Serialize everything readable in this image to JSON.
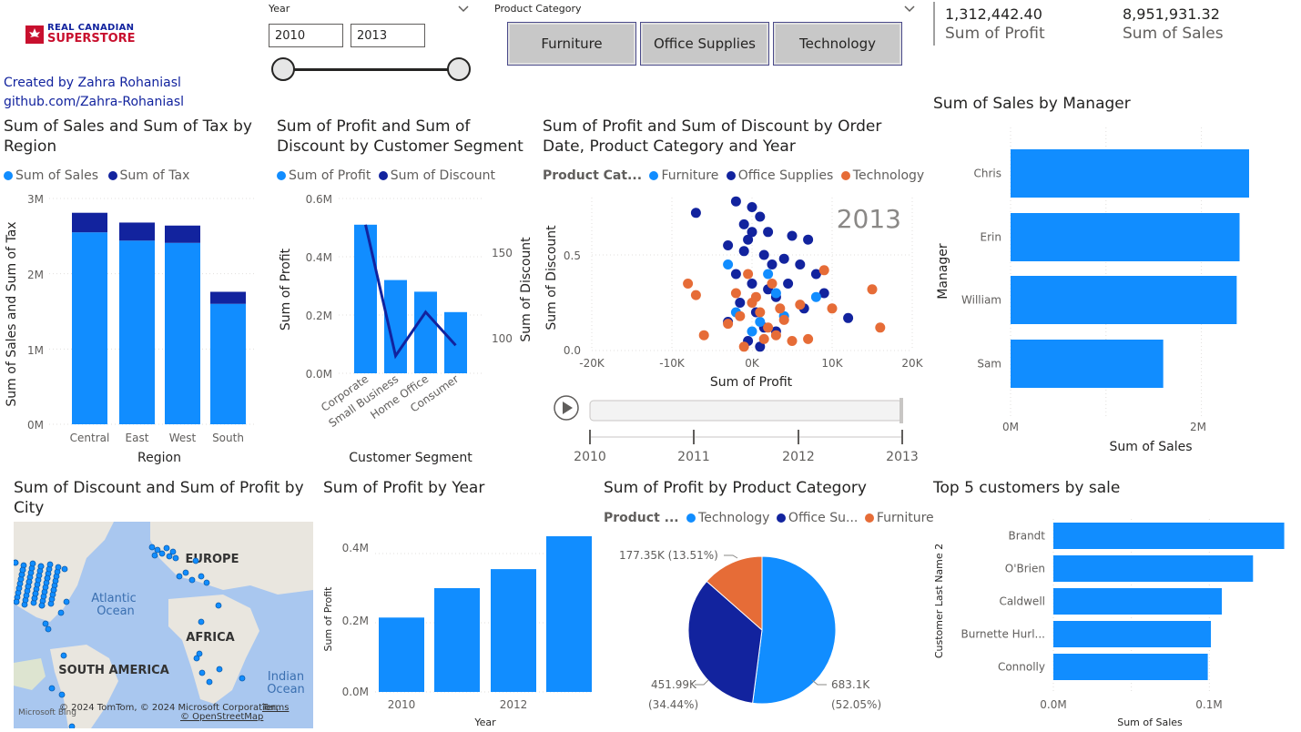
{
  "header": {
    "logo_line1": "REAL CANADIAN",
    "logo_line2": "SUPERSTORE",
    "credit_name": "Created by Zahra Rohaniasl",
    "credit_link": "github.com/Zahra-Rohaniasl"
  },
  "year_slicer": {
    "label": "Year",
    "from": "2010",
    "to": "2013"
  },
  "category_slicer": {
    "label": "Product Category",
    "options": [
      "Furniture",
      "Office Supplies",
      "Technology"
    ]
  },
  "kpis": [
    {
      "value": "1,312,442.40",
      "label": "Sum of Profit"
    },
    {
      "value": "8,951,931.32",
      "label": "Sum of Sales"
    }
  ],
  "colors": {
    "primary": "#118dff",
    "dark": "#12239e",
    "orange": "#e66c37",
    "text": "#252423",
    "muted": "#605e5c"
  },
  "charts": {
    "sales_tax_region": {
      "title": "Sum of Sales and Sum of Tax by Region",
      "legend": [
        "Sum of Sales",
        "Sum of Tax"
      ],
      "xlabel": "Region",
      "ylabel": "Sum of Sales and Sum of Tax",
      "yticks": [
        "0M",
        "1M",
        "2M",
        "3M"
      ]
    },
    "profit_discount_segment": {
      "title": "Sum of Profit and Sum of Discount by Customer Segment",
      "legend": [
        "Sum of Profit",
        "Sum of Discount"
      ],
      "xlabel": "Customer Segment",
      "ylabel": "Sum of Profit",
      "y2label": "Sum of Discount",
      "yticks": [
        "0.0M",
        "0.2M",
        "0.4M",
        "0.6M"
      ],
      "y2ticks": [
        "100",
        "150"
      ]
    },
    "scatter": {
      "title": "Sum of Profit and Sum of Discount by Order Date, Product Category and Year",
      "legend_title": "Product Cat...",
      "legend": [
        "Furniture",
        "Office Supplies",
        "Technology"
      ],
      "year_badge": "2013",
      "xlabel": "Sum of Profit",
      "ylabel": "Sum of Discount",
      "xticks": [
        "-20K",
        "-10K",
        "0K",
        "10K",
        "20K"
      ],
      "yticks": [
        "0.0",
        "0.5"
      ],
      "play_years": [
        "2010",
        "2011",
        "2012",
        "2013"
      ]
    },
    "sales_manager": {
      "title": "Sum of Sales by Manager",
      "xlabel": "Sum of Sales",
      "ylabel": "Manager",
      "xticks": [
        "0M",
        "2M"
      ]
    },
    "map": {
      "title": "Sum of Discount and Sum of Profit by City",
      "labels": {
        "europe": "EUROPE",
        "atlantic1": "Atlantic",
        "atlantic2": "Ocean",
        "africa": "AFRICA",
        "south_america": "SOUTH AMERICA",
        "indian1": "Indian",
        "indian2": "Ocean"
      },
      "attribution": "© 2024 TomTom, © 2024 Microsoft Corporation,",
      "terms": "Terms",
      "osm": "© OpenStreetMap",
      "bing": "Microsoft Bing"
    },
    "profit_year": {
      "title": "Sum of Profit by Year",
      "xlabel": "Year",
      "ylabel": "Sum of Profit",
      "yticks": [
        "0.0M",
        "0.2M",
        "0.4M"
      ],
      "xticks": [
        "2010",
        "2012"
      ]
    },
    "profit_category": {
      "title": "Sum of Profit by Product Category",
      "legend_title": "Product ...",
      "legend": [
        "Technology",
        "Office Su...",
        "Furniture"
      ],
      "labels": {
        "furniture": "177.35K (13.51%)",
        "office_a": "451.99K",
        "office_b": "(34.44%)",
        "tech_a": "683.1K",
        "tech_b": "(52.05%)"
      }
    },
    "top5": {
      "title": "Top 5 customers by sale",
      "xlabel": "Sum of Sales",
      "ylabel": "Customer Last Name 2",
      "xticks": [
        "0.0M",
        "0.1M"
      ]
    }
  },
  "chart_data": [
    {
      "type": "bar",
      "title": "Sum of Sales and Sum of Tax by Region",
      "categories": [
        "Central",
        "East",
        "West",
        "South"
      ],
      "series": [
        {
          "name": "Sum of Sales",
          "values": [
            2.55,
            2.44,
            2.41,
            1.6
          ]
        },
        {
          "name": "Sum of Tax",
          "values": [
            0.26,
            0.24,
            0.23,
            0.16
          ]
        }
      ],
      "stacked": true,
      "ylim": [
        0,
        3
      ]
    },
    {
      "type": "bar",
      "title": "Sum of Profit and Sum of Discount by Customer Segment",
      "categories": [
        "Corporate",
        "Small Business",
        "Home Office",
        "Consumer"
      ],
      "series": [
        {
          "name": "Sum of Profit",
          "values": [
            0.51,
            0.32,
            0.28,
            0.21
          ]
        },
        {
          "name": "Sum of Discount",
          "type": "line",
          "axis": "secondary",
          "values": [
            165,
            90,
            115,
            96
          ]
        }
      ],
      "ylim": [
        0,
        0.6
      ],
      "y2lim": [
        80,
        180
      ]
    },
    {
      "type": "scatter",
      "title": "Sum of Profit and Sum of Discount by Order Date, Product Category and Year",
      "series": [
        {
          "name": "Office Supplies",
          "points": [
            [
              -7000,
              0.72
            ],
            [
              -2000,
              0.78
            ],
            [
              0,
              0.75
            ],
            [
              1000,
              0.7
            ],
            [
              -1000,
              0.66
            ],
            [
              2000,
              0.62
            ],
            [
              5000,
              0.6
            ],
            [
              7000,
              0.58
            ],
            [
              -3000,
              0.55
            ],
            [
              -1000,
              0.52
            ],
            [
              1500,
              0.5
            ],
            [
              4000,
              0.48
            ],
            [
              6000,
              0.45
            ],
            [
              8000,
              0.4
            ],
            [
              9000,
              0.3
            ],
            [
              12000,
              0.17
            ],
            [
              -2000,
              0.4
            ],
            [
              0,
              0.35
            ],
            [
              2000,
              0.32
            ],
            [
              3000,
              0.28
            ],
            [
              -1500,
              0.25
            ],
            [
              500,
              0.2
            ],
            [
              1500,
              0.12
            ],
            [
              3000,
              0.1
            ],
            [
              -500,
              0.05
            ],
            [
              1000,
              0.02
            ],
            [
              -3000,
              0.15
            ],
            [
              2500,
              0.45
            ],
            [
              0,
              0.62
            ],
            [
              -500,
              0.58
            ],
            [
              4500,
              0.35
            ],
            [
              6500,
              0.22
            ]
          ]
        },
        {
          "name": "Furniture",
          "points": [
            [
              -3000,
              0.45
            ],
            [
              2000,
              0.4
            ],
            [
              3000,
              0.3
            ],
            [
              -2000,
              0.2
            ],
            [
              0,
              0.1
            ],
            [
              8000,
              0.28
            ],
            [
              1000,
              0.15
            ],
            [
              4000,
              0.18
            ]
          ]
        },
        {
          "name": "Technology",
          "points": [
            [
              -8000,
              0.35
            ],
            [
              -7000,
              0.29
            ],
            [
              -3000,
              0.14
            ],
            [
              -2000,
              0.3
            ],
            [
              0,
              0.25
            ],
            [
              1000,
              0.2
            ],
            [
              2000,
              0.12
            ],
            [
              3000,
              0.08
            ],
            [
              4000,
              0.16
            ],
            [
              5000,
              0.05
            ],
            [
              -1000,
              0.02
            ],
            [
              9000,
              0.42
            ],
            [
              10000,
              0.22
            ],
            [
              15000,
              0.32
            ],
            [
              16000,
              0.12
            ],
            [
              -6000,
              0.08
            ],
            [
              6000,
              0.24
            ],
            [
              2500,
              0.35
            ],
            [
              -500,
              0.4
            ],
            [
              1500,
              0.06
            ],
            [
              500,
              0.28
            ],
            [
              3500,
              0.22
            ],
            [
              -1500,
              0.18
            ],
            [
              7000,
              0.06
            ]
          ]
        }
      ],
      "xlim": [
        -20000,
        20000
      ],
      "ylim": [
        0,
        0.8
      ]
    },
    {
      "type": "bar",
      "title": "Sum of Sales by Manager",
      "orientation": "horizontal",
      "categories": [
        "Chris",
        "Erin",
        "William",
        "Sam"
      ],
      "values": [
        2.5,
        2.4,
        2.37,
        1.6
      ],
      "xlim": [
        0,
        2.5
      ]
    },
    {
      "type": "bar",
      "title": "Sum of Profit by Year",
      "categories": [
        "2010",
        "2011",
        "2012",
        "2013"
      ],
      "values": [
        0.215,
        0.3,
        0.355,
        0.45
      ],
      "ylim": [
        0,
        0.5
      ]
    },
    {
      "type": "pie",
      "title": "Sum of Profit by Product Category",
      "categories": [
        "Technology",
        "Office Supplies",
        "Furniture"
      ],
      "values": [
        683.1,
        451.99,
        177.35
      ]
    },
    {
      "type": "bar",
      "title": "Top 5 customers by sale",
      "orientation": "horizontal",
      "categories": [
        "Brandt",
        "O'Brien",
        "Caldwell",
        "Burnette Hurl...",
        "Connolly"
      ],
      "values": [
        0.148,
        0.128,
        0.108,
        0.101,
        0.099
      ],
      "xlim": [
        0,
        0.15
      ]
    }
  ]
}
